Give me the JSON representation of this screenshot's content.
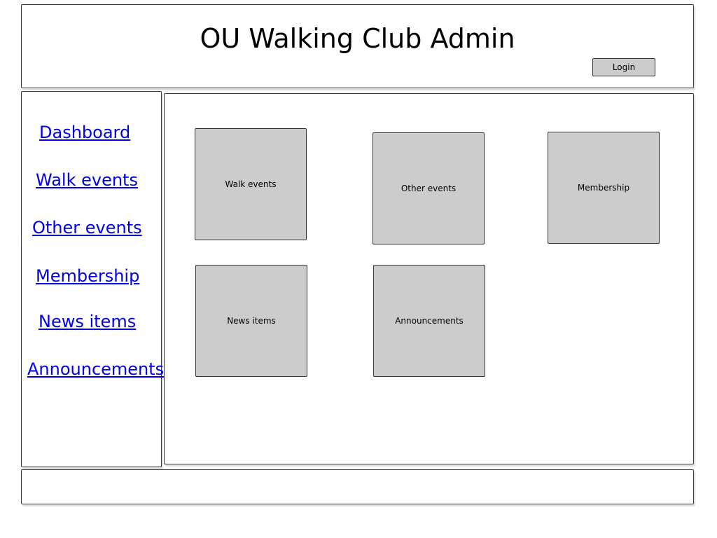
{
  "header": {
    "title": "OU Walking Club Admin",
    "login_label": "Login"
  },
  "sidebar": {
    "items": [
      {
        "label": "Dashboard"
      },
      {
        "label": "Walk events"
      },
      {
        "label": "Other events"
      },
      {
        "label": "Membership"
      },
      {
        "label": "News items"
      },
      {
        "label": "Announcements"
      }
    ]
  },
  "main": {
    "tiles": [
      {
        "label": "Walk events"
      },
      {
        "label": "Other events"
      },
      {
        "label": "Membership"
      },
      {
        "label": "News items"
      },
      {
        "label": "Announcements"
      }
    ]
  },
  "colors": {
    "link": "#0000ee",
    "tile_fill": "#cccccc",
    "border": "#333333"
  }
}
